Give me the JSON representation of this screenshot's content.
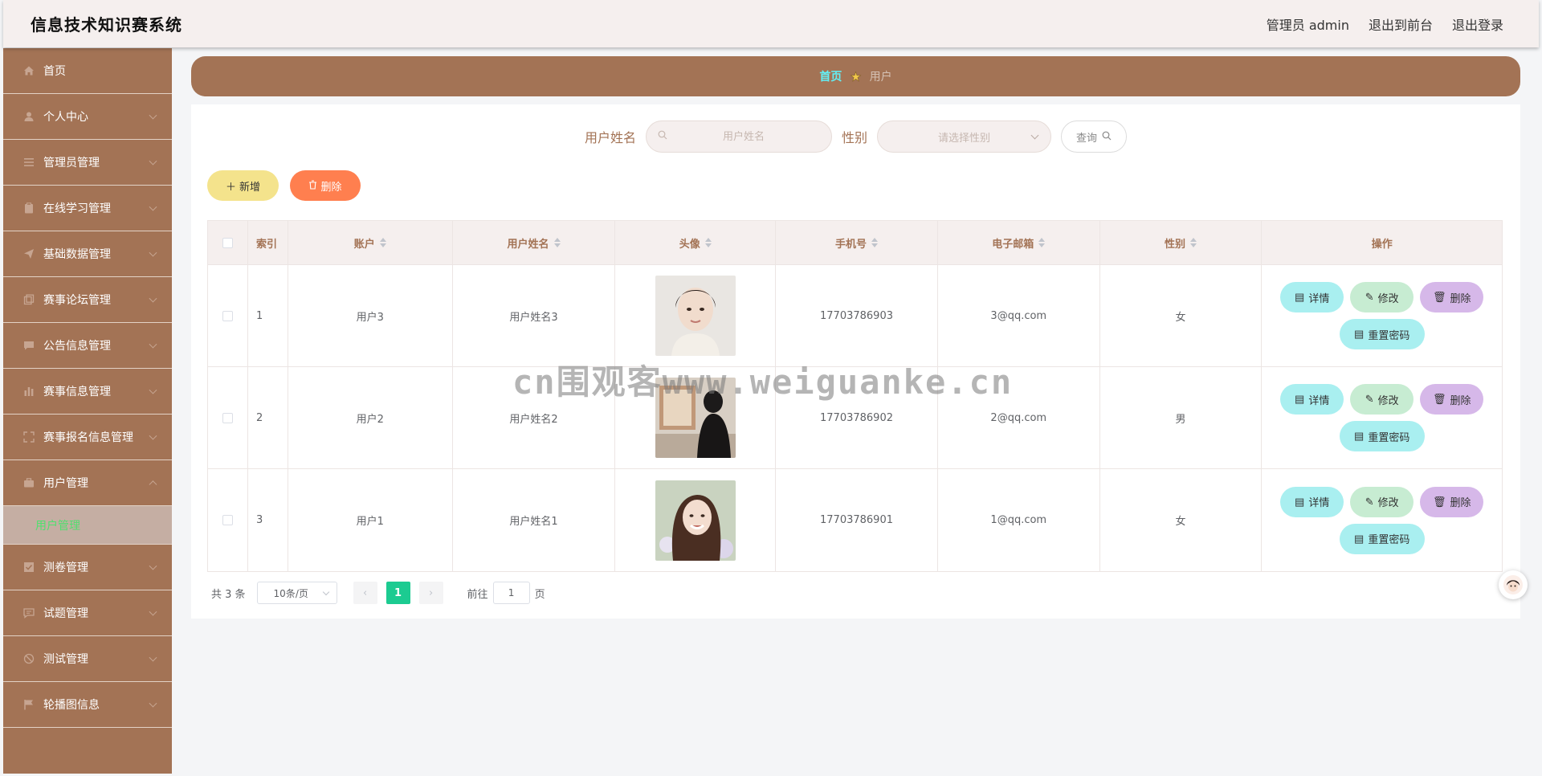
{
  "app": {
    "title": "信息技术知识赛系统",
    "admin_label": "管理员 admin",
    "front_label": "退出到前台",
    "logout_label": "退出登录"
  },
  "sidebar": {
    "items": [
      {
        "label": "首页",
        "icon": "home-icon",
        "expandable": false
      },
      {
        "label": "个人中心",
        "icon": "user-icon",
        "expandable": true
      },
      {
        "label": "管理员管理",
        "icon": "list-icon",
        "expandable": true
      },
      {
        "label": "在线学习管理",
        "icon": "clipboard-icon",
        "expandable": true
      },
      {
        "label": "基础数据管理",
        "icon": "send-icon",
        "expandable": true
      },
      {
        "label": "赛事论坛管理",
        "icon": "copy-icon",
        "expandable": true
      },
      {
        "label": "公告信息管理",
        "icon": "chat-icon",
        "expandable": true
      },
      {
        "label": "赛事信息管理",
        "icon": "chart-icon",
        "expandable": true
      },
      {
        "label": "赛事报名信息管理",
        "icon": "fullscreen-icon",
        "expandable": true
      },
      {
        "label": "用户管理",
        "icon": "briefcase-icon",
        "expandable": true,
        "open": true
      },
      {
        "label": "测卷管理",
        "icon": "checkbox-icon",
        "expandable": true
      },
      {
        "label": "试题管理",
        "icon": "message-icon",
        "expandable": true
      },
      {
        "label": "测试管理",
        "icon": "no-icon",
        "expandable": true
      },
      {
        "label": "轮播图信息",
        "icon": "flag-icon",
        "expandable": true
      }
    ],
    "submenu_label": "用户管理"
  },
  "breadcrumb": {
    "home": "首页",
    "current": "用户"
  },
  "search": {
    "name_label": "用户姓名",
    "name_placeholder": "用户姓名",
    "sex_label": "性别",
    "sex_placeholder": "请选择性别",
    "query_label": "查询"
  },
  "actions": {
    "add_label": "新增",
    "delete_label": "删除"
  },
  "table": {
    "headers": {
      "index": "索引",
      "account": "账户",
      "name": "用户姓名",
      "avatar": "头像",
      "phone": "手机号",
      "email": "电子邮箱",
      "sex": "性别",
      "ops": "操作"
    },
    "rows": [
      {
        "index": "1",
        "account": "用户3",
        "name": "用户姓名3",
        "phone": "17703786903",
        "email": "3@qq.com",
        "sex": "女"
      },
      {
        "index": "2",
        "account": "用户2",
        "name": "用户姓名2",
        "phone": "17703786902",
        "email": "2@qq.com",
        "sex": "男"
      },
      {
        "index": "3",
        "account": "用户1",
        "name": "用户姓名1",
        "phone": "17703786901",
        "email": "1@qq.com",
        "sex": "女"
      }
    ],
    "op_labels": {
      "detail": "详情",
      "edit": "修改",
      "remove": "删除",
      "reset": "重置密码"
    }
  },
  "pagination": {
    "total": "共 3 条",
    "page_size": "10条/页",
    "current_page": "1",
    "goto_label": "前往",
    "goto_value": "1",
    "page_unit": "页"
  },
  "watermark": "cn围观客www.weiguanke.cn",
  "colors": {
    "sidebar_bg": "#a37355",
    "header_bg": "#f5efee",
    "accent_green": "#1ccb91",
    "breadcrumb_home": "#62f0f7"
  }
}
